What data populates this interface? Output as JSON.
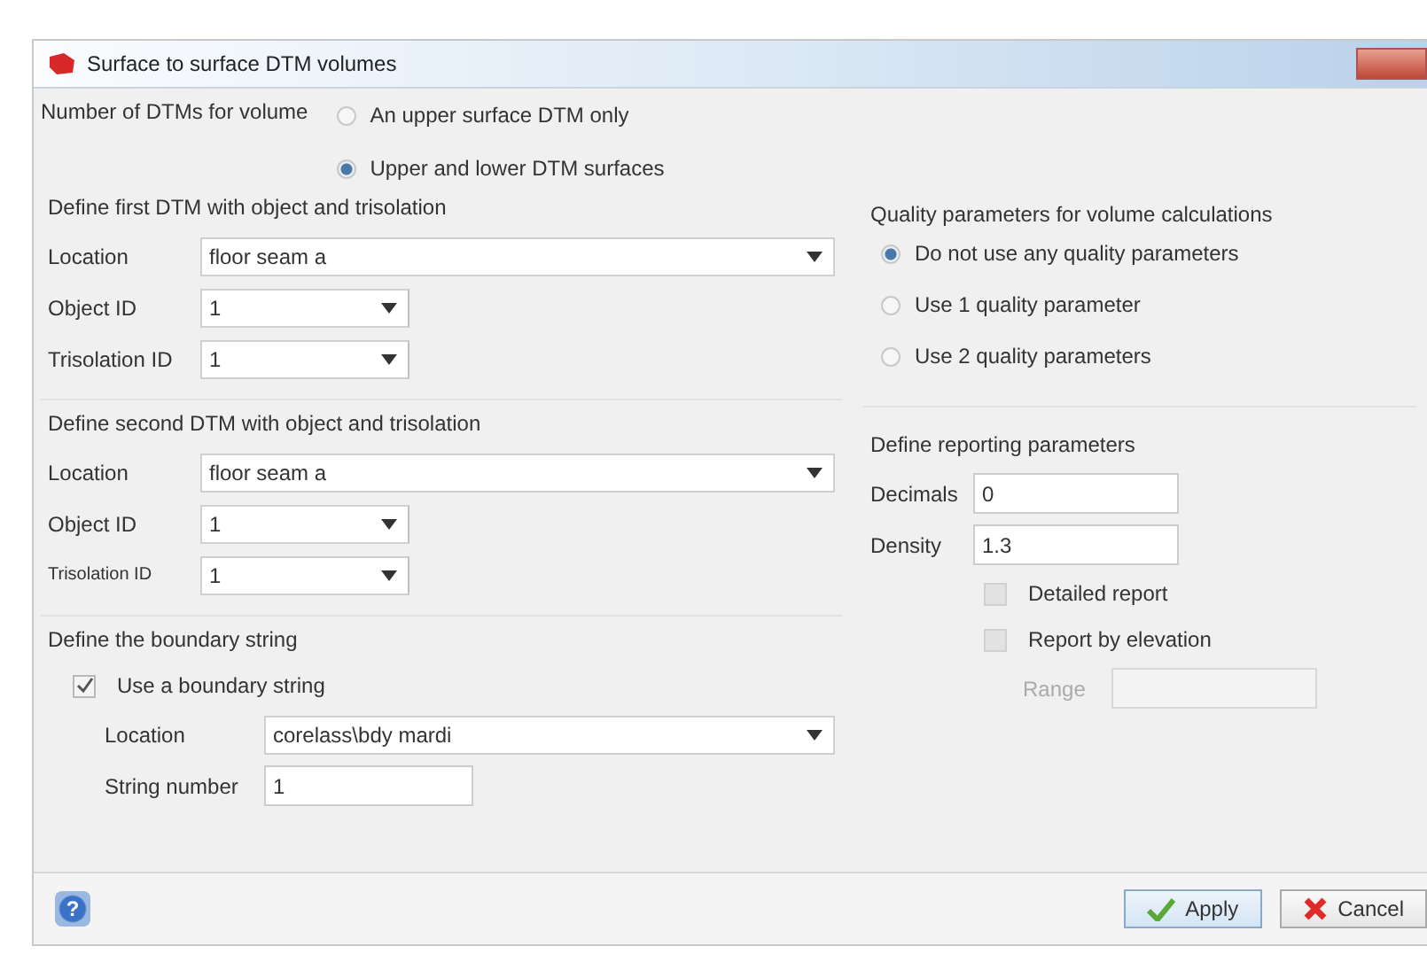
{
  "window": {
    "title": "Surface to surface DTM volumes"
  },
  "dtm_count": {
    "label": "Number of DTMs for volume",
    "options": [
      {
        "label": "An upper surface DTM only",
        "selected": false
      },
      {
        "label": "Upper and lower DTM surfaces",
        "selected": true
      }
    ]
  },
  "first_dtm": {
    "heading": "Define first DTM with object and trisolation",
    "fields": [
      {
        "label": "Location",
        "value": "floor seam a",
        "kind": "location"
      },
      {
        "label": "Object ID",
        "value": "1",
        "kind": "id"
      },
      {
        "label": "Trisolation ID",
        "value": "1",
        "kind": "id"
      }
    ]
  },
  "second_dtm": {
    "heading": "Define second DTM with object and trisolation",
    "fields": [
      {
        "label": "Location",
        "value": "floor seam a",
        "kind": "location"
      },
      {
        "label": "Object ID",
        "value": "1",
        "kind": "id"
      },
      {
        "label": "Trisolation ID",
        "value": "1",
        "kind": "id"
      }
    ]
  },
  "boundary": {
    "heading": "Define the boundary string",
    "checkbox": {
      "label": "Use a boundary string",
      "checked": true
    },
    "fields": [
      {
        "label": "Location",
        "value": "corelass\\bdy mardi",
        "kind": "location"
      },
      {
        "label": "String number",
        "value": "1",
        "kind": "text"
      }
    ]
  },
  "quality": {
    "heading": "Quality parameters for volume calculations",
    "options": [
      {
        "label": "Do not use any quality parameters",
        "selected": true
      },
      {
        "label": "Use 1 quality parameter",
        "selected": false
      },
      {
        "label": "Use 2 quality parameters",
        "selected": false
      }
    ]
  },
  "reporting": {
    "heading": "Define reporting parameters",
    "fields": [
      {
        "label": "Decimals",
        "value": "0"
      },
      {
        "label": "Density",
        "value": "1.3"
      }
    ],
    "checkboxes": [
      {
        "label": "Detailed report",
        "checked": false
      },
      {
        "label": "Report by elevation",
        "checked": false
      }
    ],
    "range": {
      "label": "Range",
      "disabled": true
    }
  },
  "footer": {
    "help": "?",
    "buttons": [
      {
        "label": "Apply",
        "kind": "apply"
      },
      {
        "label": "Cancel",
        "kind": "cancel"
      }
    ]
  }
}
